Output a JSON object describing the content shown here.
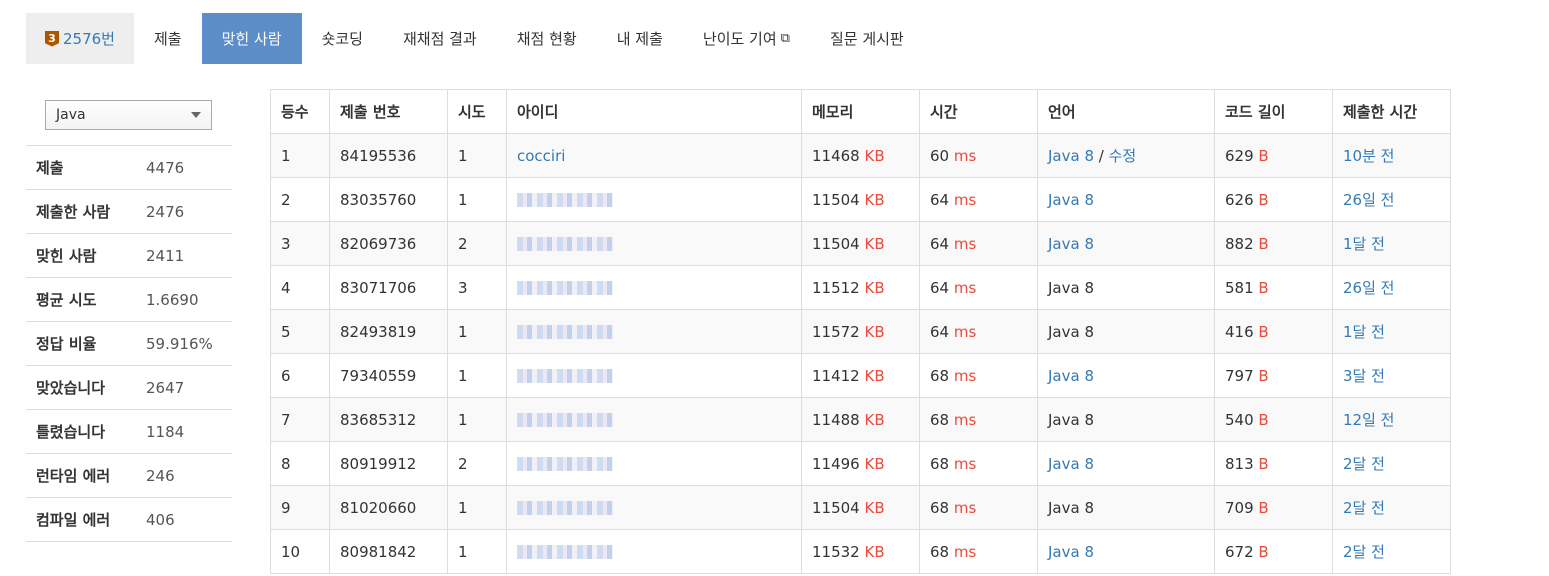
{
  "nav": {
    "problem_badge": "3",
    "problem_label": "2576번",
    "items": [
      "제출",
      "맞힌 사람",
      "숏코딩",
      "재채점 결과",
      "채점 현황",
      "내 제출",
      "난이도 기여",
      "질문 게시판"
    ]
  },
  "sidebar": {
    "language_select": "Java",
    "stats": [
      {
        "label": "제출",
        "value": "4476"
      },
      {
        "label": "제출한 사람",
        "value": "2476"
      },
      {
        "label": "맞힌 사람",
        "value": "2411"
      },
      {
        "label": "평균 시도",
        "value": "1.6690"
      },
      {
        "label": "정답 비율",
        "value": "59.916%"
      },
      {
        "label": "맞았습니다",
        "value": "2647"
      },
      {
        "label": "틀렸습니다",
        "value": "1184"
      },
      {
        "label": "런타임 에러",
        "value": "246"
      },
      {
        "label": "컴파일 에러",
        "value": "406"
      }
    ]
  },
  "table": {
    "headers": [
      "등수",
      "제출 번호",
      "시도",
      "아이디",
      "메모리",
      "시간",
      "언어",
      "코드 길이",
      "제출한 시간"
    ],
    "units": {
      "memory": "KB",
      "time": "ms",
      "length": "B"
    },
    "edit_label": "수정",
    "rows": [
      {
        "rank": "1",
        "id": "84195536",
        "tries": "1",
        "user": "cocciri",
        "mem": "11468",
        "time": "60",
        "lang": "Java 8",
        "len": "629",
        "ago": "10분 전"
      },
      {
        "rank": "2",
        "id": "83035760",
        "tries": "1",
        "user": "",
        "mem": "11504",
        "time": "64",
        "lang": "Java 8",
        "len": "626",
        "ago": "26일 전"
      },
      {
        "rank": "3",
        "id": "82069736",
        "tries": "2",
        "user": "",
        "mem": "11504",
        "time": "64",
        "lang": "Java 8",
        "len": "882",
        "ago": "1달 전"
      },
      {
        "rank": "4",
        "id": "83071706",
        "tries": "3",
        "user": "",
        "mem": "11512",
        "time": "64",
        "lang": "Java 8",
        "len": "581",
        "ago": "26일 전"
      },
      {
        "rank": "5",
        "id": "82493819",
        "tries": "1",
        "user": "",
        "mem": "11572",
        "time": "64",
        "lang": "Java 8",
        "len": "416",
        "ago": "1달 전"
      },
      {
        "rank": "6",
        "id": "79340559",
        "tries": "1",
        "user": "",
        "mem": "11412",
        "time": "68",
        "lang": "Java 8",
        "len": "797",
        "ago": "3달 전"
      },
      {
        "rank": "7",
        "id": "83685312",
        "tries": "1",
        "user": "",
        "mem": "11488",
        "time": "68",
        "lang": "Java 8",
        "len": "540",
        "ago": "12일 전"
      },
      {
        "rank": "8",
        "id": "80919912",
        "tries": "2",
        "user": "",
        "mem": "11496",
        "time": "68",
        "lang": "Java 8",
        "len": "813",
        "ago": "2달 전"
      },
      {
        "rank": "9",
        "id": "81020660",
        "tries": "1",
        "user": "",
        "mem": "11504",
        "time": "68",
        "lang": "Java 8",
        "len": "709",
        "ago": "2달 전"
      },
      {
        "rank": "10",
        "id": "80981842",
        "tries": "1",
        "user": "",
        "mem": "11532",
        "time": "68",
        "lang": "Java 8",
        "len": "672",
        "ago": "2달 전"
      }
    ]
  }
}
